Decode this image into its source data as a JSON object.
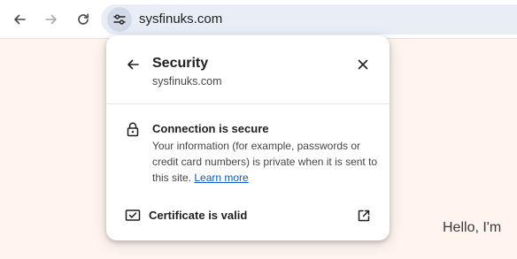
{
  "toolbar": {
    "url": "sysfinuks.com",
    "back_icon": "back-arrow-icon",
    "forward_icon": "forward-arrow-icon",
    "reload_icon": "reload-icon",
    "site_settings_icon": "tune-icon"
  },
  "popup": {
    "title": "Security",
    "subtitle": "sysfinuks.com",
    "connection": {
      "heading": "Connection is secure",
      "description": "Your information (for example, passwords or credit card numbers) is private when it is sent to this site.",
      "learn_more": "Learn more"
    },
    "certificate": {
      "label": "Certificate is valid"
    }
  },
  "page": {
    "greeting": "Hello, I'm"
  },
  "colors": {
    "page_background": "#fff4ee",
    "omnibox_background": "#e9edf6",
    "link": "#0b57d0",
    "text_primary": "#1f1f1f",
    "text_secondary": "#444746"
  }
}
